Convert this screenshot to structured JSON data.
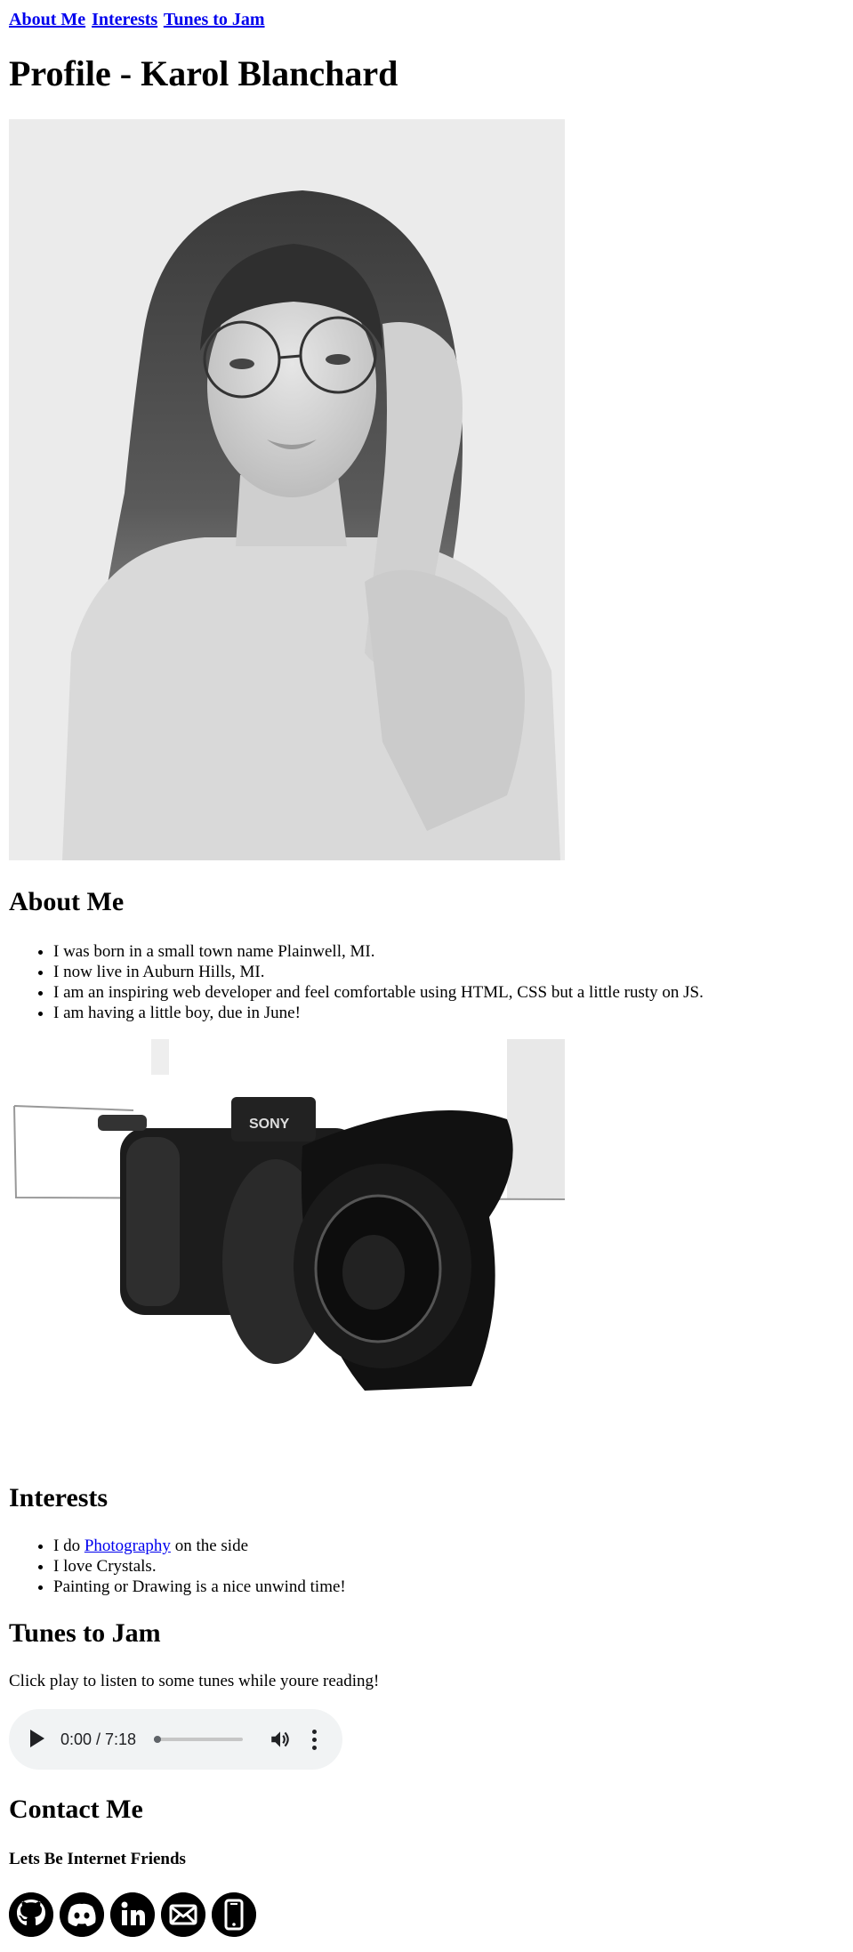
{
  "nav": {
    "links": [
      "About Me",
      "Interests",
      "Tunes to Jam"
    ]
  },
  "page": {
    "title": "Profile - Karol Blanchard"
  },
  "about": {
    "heading": "About Me",
    "items": [
      "I was born in a small town name Plainwell, MI.",
      "I now live in Auburn Hills, MI.",
      "I am an inspiring web developer and feel comfortable using HTML, CSS but a little rusty on JS.",
      "I am having a little boy, due in June!"
    ]
  },
  "interests": {
    "heading": "Interests",
    "item1_prefix": "I do ",
    "item1_link": "Photography",
    "item1_suffix": " on the side",
    "item2": "I love Crystals.",
    "item3": "Painting or Drawing is a nice unwind time!"
  },
  "tunes": {
    "heading": "Tunes to Jam",
    "text": "Click play to listen to some tunes while youre reading!",
    "player": {
      "time": "0:00 / 7:18",
      "progress": 0.0
    }
  },
  "contact": {
    "heading": "Contact Me",
    "subheading": "Lets Be Internet Friends",
    "icons": [
      "github-icon",
      "discord-icon",
      "linkedin-icon",
      "email-icon",
      "phone-icon"
    ]
  }
}
